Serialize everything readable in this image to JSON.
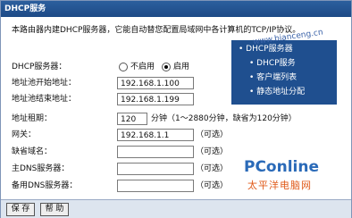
{
  "window": {
    "title": "DHCP服务"
  },
  "description": "本路由器内建DHCP服务器，它能自动替您配置局域网中各计算机的TCP/IP协议。",
  "form": {
    "dhcp_server_label": "DHCP服务器：",
    "radio_disable_label": "不启用",
    "radio_enable_label": "启用",
    "radio_selected": "启用",
    "pool_start_label": "地址池开始地址：",
    "pool_start_value": "192.168.1.100",
    "pool_end_label": "地址池结束地址：",
    "pool_end_value": "192.168.1.199",
    "lease_label": "地址租期：",
    "lease_value": "120",
    "lease_hint": "分钟（1～2880分钟，缺省为120分钟）",
    "gateway_label": "网关：",
    "gateway_value": "192.168.1.1",
    "optional": "（可选）",
    "domain_label": "缺省域名：",
    "domain_value": "",
    "dns1_label": "主DNS服务器：",
    "dns1_value": "",
    "dns2_label": "备用DNS服务器：",
    "dns2_value": ""
  },
  "help_panel": {
    "header": "• DHCP服务器",
    "items": [
      "• DHCP服务",
      "• 客户端列表",
      "• 静态地址分配"
    ]
  },
  "buttons": {
    "save": "保 存",
    "help": "帮 助"
  },
  "watermark": {
    "logo": "PConline",
    "subtitle": "太平洋电脑网",
    "url": "www.bianceng.cn"
  },
  "colors": {
    "title_bar": "#1d4a86",
    "help_panel": "#1f4f8f",
    "bottom_bar": "#dde5ef"
  }
}
